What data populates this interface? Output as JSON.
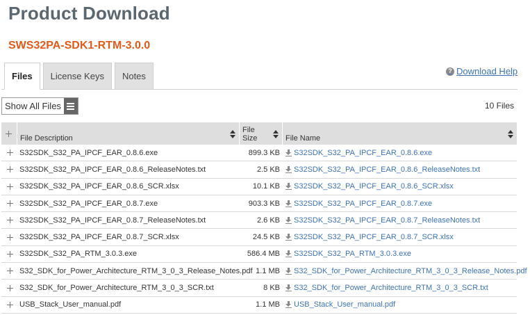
{
  "page": {
    "title": "Product Download",
    "product_code": "SWS32PA-SDK1-RTM-3.0.0"
  },
  "tabs": [
    {
      "label": "Files",
      "active": true
    },
    {
      "label": "License Keys",
      "active": false
    },
    {
      "label": "Notes",
      "active": false
    }
  ],
  "help": {
    "icon": "question-circle-icon",
    "label": "Download Help"
  },
  "filter": {
    "label": "Show All Files",
    "icon": "menu-icon"
  },
  "file_count": "10 Files",
  "table": {
    "headers": {
      "description": "File Description",
      "size_line1": "File",
      "size_line2": "Size",
      "name": "File Name"
    },
    "rows": [
      {
        "description": "S32SDK_S32_PA_IPCF_EAR_0.8.6.exe",
        "size": "899.3 KB",
        "name": "S32SDK_S32_PA_IPCF_EAR_0.8.6.exe"
      },
      {
        "description": "S32SDK_S32_PA_IPCF_EAR_0.8.6_ReleaseNotes.txt",
        "size": "2.5 KB",
        "name": "S32SDK_S32_PA_IPCF_EAR_0.8.6_ReleaseNotes.txt"
      },
      {
        "description": "S32SDK_S32_PA_IPCF_EAR_0.8.6_SCR.xlsx",
        "size": "10.1 KB",
        "name": "S32SDK_S32_PA_IPCF_EAR_0.8.6_SCR.xlsx"
      },
      {
        "description": "S32SDK_S32_PA_IPCF_EAR_0.8.7.exe",
        "size": "903.3 KB",
        "name": "S32SDK_S32_PA_IPCF_EAR_0.8.7.exe"
      },
      {
        "description": "S32SDK_S32_PA_IPCF_EAR_0.8.7_ReleaseNotes.txt",
        "size": "2.6 KB",
        "name": "S32SDK_S32_PA_IPCF_EAR_0.8.7_ReleaseNotes.txt"
      },
      {
        "description": "S32SDK_S32_PA_IPCF_EAR_0.8.7_SCR.xlsx",
        "size": "24.5 KB",
        "name": "S32SDK_S32_PA_IPCF_EAR_0.8.7_SCR.xlsx"
      },
      {
        "description": "S32SDK_S32_PA_RTM_3.0.3.exe",
        "size": "586.4 MB",
        "name": "S32SDK_S32_PA_RTM_3.0.3.exe"
      },
      {
        "description": "S32_SDK_for_Power_Architecture_RTM_3_0_3_Release_Notes.pdf",
        "size": "1.1 MB",
        "name": "S32_SDK_for_Power_Architecture_RTM_3_0_3_Release_Notes.pdf"
      },
      {
        "description": "S32_SDK_for_Power_Architecture_RTM_3_0_3_SCR.txt",
        "size": "8 KB",
        "name": "S32_SDK_for_Power_Architecture_RTM_3_0_3_SCR.txt"
      },
      {
        "description": "USB_Stack_User_manual.pdf",
        "size": "1.1 MB",
        "name": "USB_Stack_User_manual.pdf"
      }
    ]
  },
  "colors": {
    "title": "#5b6770",
    "product_code": "#e05a1b",
    "link": "#3d73b8",
    "header_bg": "#dedede"
  }
}
